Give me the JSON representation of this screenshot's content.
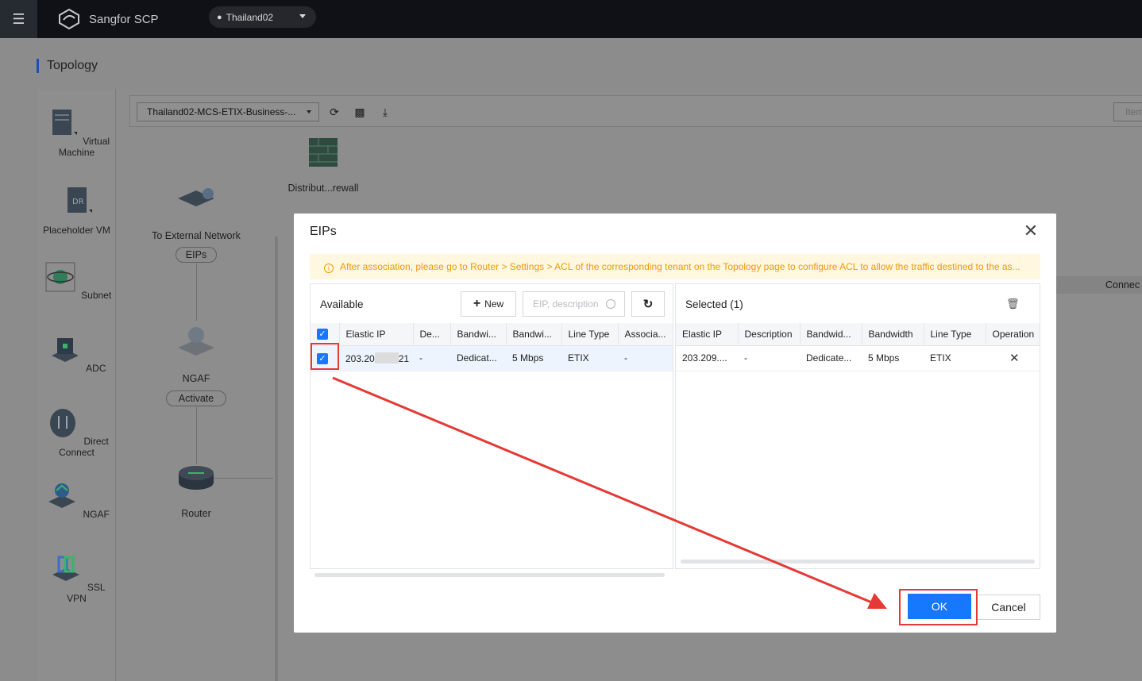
{
  "topbar": {
    "brand": "Sangfor SCP",
    "region": "Thailand02"
  },
  "page": {
    "title": "Topology",
    "project_select": "Thailand02-MCS-ETIX-Business-...",
    "items_box": "Item"
  },
  "palette": [
    {
      "label": "Virtual Machine"
    },
    {
      "label": "Placeholder VM"
    },
    {
      "label": "Subnet"
    },
    {
      "label": "ADC"
    },
    {
      "label": "Direct Connect"
    },
    {
      "label": "NGAF"
    },
    {
      "label": "SSL VPN"
    }
  ],
  "topology": {
    "firewall_label": "Distribut...rewall",
    "external_label": "To External Network",
    "eips_pill": "EIPs",
    "ngaf_label": "NGAF",
    "activate_pill": "Activate",
    "router_label": "Router",
    "connect_label": "Connec"
  },
  "modal": {
    "title": "EIPs",
    "notice": "After association, please go to Router > Settings > ACL of the corresponding tenant on the Topology page to configure ACL to allow the traffic destined to the as...",
    "available": {
      "title": "Available",
      "new_label": "New",
      "search_placeholder": "EIP, description",
      "columns": [
        "Elastic IP",
        "De...",
        "Bandwi...",
        "Bandwi...",
        "Line Type",
        "Associa..."
      ],
      "rows": [
        {
          "ip_prefix": "203.20",
          "ip_suffix": "21",
          "description": "-",
          "bandwidth_type": "Dedicat...",
          "bandwidth": "5 Mbps",
          "line_type": "ETIX",
          "associated": "-"
        }
      ]
    },
    "selected": {
      "title": "Selected (1)",
      "columns": [
        "Elastic IP",
        "Description",
        "Bandwid...",
        "Bandwidth",
        "Line Type",
        "Operation"
      ],
      "rows": [
        {
          "ip": "203.209....",
          "description": "-",
          "bandwidth_type": "Dedicate...",
          "bandwidth": "5 Mbps",
          "line_type": "ETIX"
        }
      ]
    },
    "ok_label": "OK",
    "cancel_label": "Cancel"
  },
  "colors": {
    "primary": "#1677ff",
    "annotation": "#e53935",
    "notice_text": "#ef9b06",
    "topbar": "#0f1117"
  }
}
